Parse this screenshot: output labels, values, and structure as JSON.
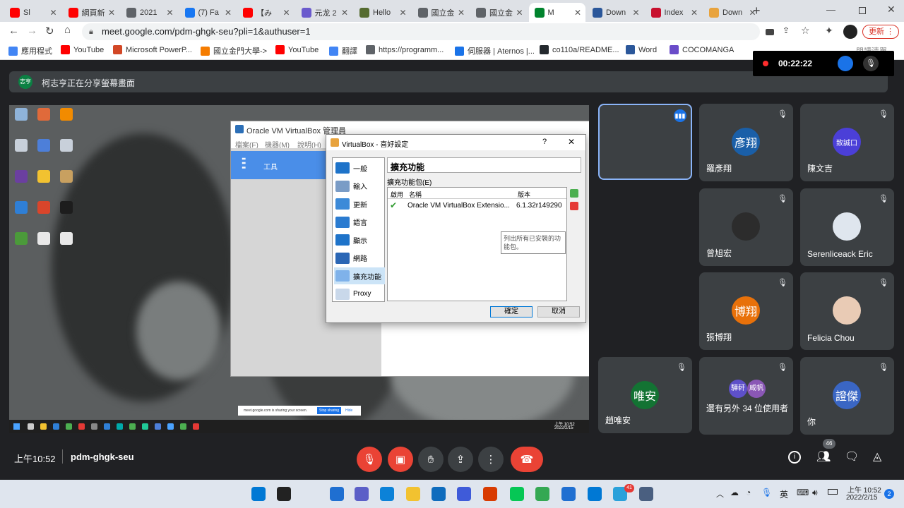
{
  "tabs": [
    {
      "label": "Sl",
      "color": "#ff0000"
    },
    {
      "label": "網頁新",
      "color": "#ff0000"
    },
    {
      "label": "2021",
      "color": "#5f6368"
    },
    {
      "label": "(7) Fa",
      "color": "#1877f2"
    },
    {
      "label": "【み",
      "color": "#ff0000"
    },
    {
      "label": "元龙 2",
      "color": "#6a5acd"
    },
    {
      "label": "Hello",
      "color": "#556b2f"
    },
    {
      "label": "國立金",
      "color": "#5f6368"
    },
    {
      "label": "國立金",
      "color": "#5f6368"
    },
    {
      "label": "M",
      "color": "#00832d"
    },
    {
      "label": "Down",
      "color": "#2b579a"
    },
    {
      "label": "Index",
      "color": "#c8102e"
    },
    {
      "label": "Down",
      "color": "#e8a33d"
    }
  ],
  "address": {
    "url": "meet.google.com/pdm-ghgk-seu?pli=1&authuser=1",
    "update_label": "更新"
  },
  "bookmarks": [
    {
      "label": "應用程式",
      "color": "#4285f4"
    },
    {
      "label": "YouTube",
      "color": "#ff0000"
    },
    {
      "label": "Microsoft PowerP...",
      "color": "#d24726"
    },
    {
      "label": "國立金門大學->",
      "color": "#f57c00"
    },
    {
      "label": "YouTube",
      "color": "#ff0000"
    },
    {
      "label": "翻譯",
      "color": "#4285f4"
    },
    {
      "label": "https://programm...",
      "color": "#5f6368"
    },
    {
      "label": "伺服器 | Aternos |...",
      "color": "#1a73e8"
    },
    {
      "label": "co110a/README...",
      "color": "#24292e"
    },
    {
      "label": "Word",
      "color": "#2b579a"
    },
    {
      "label": "COCOMANGA",
      "color": "#6a4cc9"
    }
  ],
  "reading_list": "閱讀清單",
  "recorder": {
    "time": "00:22:22"
  },
  "banner": {
    "avatar_text": "志亨",
    "text": "柯志亨正在分享螢幕畫面"
  },
  "vbox": {
    "main_title": "Oracle VM VirtualBox 管理員",
    "menu": [
      "檔案(F)",
      "機器(M)",
      "說明(H)"
    ],
    "tools_label": "工具",
    "dialog_title": "VirtualBox - 喜好設定",
    "sidebar": [
      "一般",
      "輸入",
      "更新",
      "語言",
      "顯示",
      "網路",
      "擴充功能",
      "Proxy"
    ],
    "section_title": "擴充功能",
    "group_label": "擴充功能包(E)",
    "col_enabled": "啟用",
    "col_name": "名稱",
    "col_version": "版本",
    "ext_name": "Oracle VM VirtualBox Extensio...",
    "ext_version": "6.1.32r149290",
    "tooltip": "列出所有已安裝的功能包。",
    "ok": "確定",
    "cancel": "取消",
    "help": "?"
  },
  "share_notice": {
    "text": "meet.google.com is sharing your screen.",
    "stop": "Stop sharing",
    "hide": "Hide"
  },
  "inner_clock": {
    "time": "上午 10:52",
    "date": "2022/2/15"
  },
  "participants": [
    {
      "name": "",
      "avatar": "",
      "color": "#3c4043",
      "speaking": true
    },
    {
      "name": "羅彥翔",
      "avatar": "彥翔",
      "color": "#1a5fa8"
    },
    {
      "name": "陳文吉",
      "avatar": "致誠口",
      "color": "#4b3fd8"
    },
    {
      "name": "曾旭宏",
      "avatar": "",
      "color": "#2c2c2c"
    },
    {
      "name": "Serenliceack Eric",
      "avatar": "",
      "color": "#dfe6ee"
    },
    {
      "name": "張博翔",
      "avatar": "博翔",
      "color": "#e8710a"
    },
    {
      "name": "Felicia Chou",
      "avatar": "",
      "color": "#e9cbb5"
    },
    {
      "name": "趙唯安",
      "avatar": "唯安",
      "color": "#137333"
    },
    {
      "name": "還有另外 34 位使用者",
      "avatar": "",
      "color": "#3c4043"
    },
    {
      "name": "你",
      "avatar": "證傑",
      "color": "#3a66c4"
    }
  ],
  "others_avatars": [
    "驊軒",
    "威帆"
  ],
  "meeting": {
    "time": "上午10:52",
    "code": "pdm-ghgk-seu",
    "people_count": "46"
  },
  "taskbar": {
    "lang": "英",
    "time": "上午 10:52",
    "date": "2022/2/15",
    "notif": "2",
    "badge": "41"
  }
}
